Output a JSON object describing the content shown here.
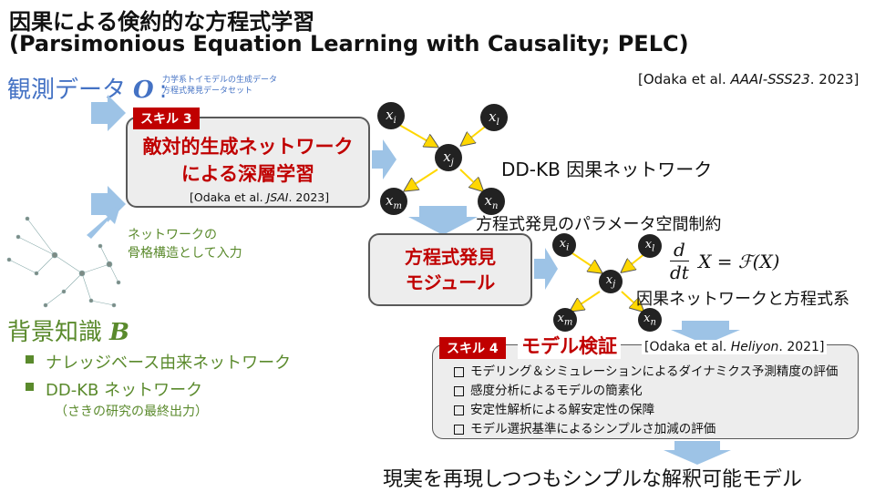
{
  "title": {
    "line1": "因果による倹約的な方程式学習",
    "line2": "(Parsimonious Equation Learning with Causality; PELC)"
  },
  "citation_main": "[Odaka et al. AAAI-SSS23. 2023]",
  "observed": {
    "label": "観測データ",
    "symbol": "O",
    "colon": ":",
    "notes": [
      "力学系トイモデルの生成データ",
      "方程式発見データセット"
    ]
  },
  "skill3": {
    "badge": "スキル 3",
    "line1": "敵対的生成ネットワーク",
    "line2": "による深層学習",
    "citation": "[Odaka et al. JSAI. 2023]"
  },
  "network_input": [
    "ネットワークの",
    "骨格構造として入力"
  ],
  "background": {
    "label": "背景知識",
    "symbol": "B",
    "items": [
      "ナレッジベース由来ネットワーク",
      "DD-KB ネットワーク"
    ],
    "sub": "（さきの研究の最終出力）"
  },
  "ddkb_label": "DD-KB 因果ネットワーク",
  "param_label": "方程式発見のパラメータ空間制約",
  "module": {
    "line1": "方程式発見",
    "line2": "モジュール"
  },
  "equation": {
    "num": "d",
    "den": "dt",
    "rhs": "X  = ℱ(X)"
  },
  "causal_eq_label": "因果ネットワークと方程式系",
  "skill4": {
    "badge": "スキル 4",
    "title": "モデル検証",
    "citation": "[Odaka et al. Heliyon. 2021]",
    "items": [
      "モデリング＆シミュレーションによるダイナミクス予測精度の評価",
      "感度分析によるモデルの簡素化",
      "安定性解析による解安定性の保障",
      "モデル選択基準によるシンプルさ加減の評価"
    ]
  },
  "conclusion": "現実を再現しつつもシンプルな解釈可能モデル",
  "nodes": {
    "i": "i",
    "l": "l",
    "j": "j",
    "m": "m",
    "n": "n"
  },
  "colors": {
    "accent_red": "#c00000",
    "blue": "#4472c4",
    "green": "#5a8a2c",
    "arrow": "#9dc3e6",
    "edge": "#ffd700"
  }
}
